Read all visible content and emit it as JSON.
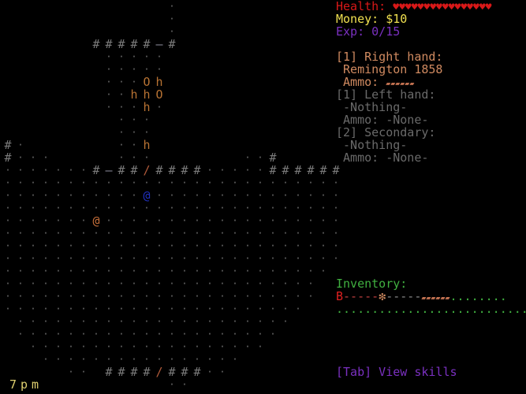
{
  "hud": {
    "health_label": "Health: ",
    "health_hearts": "♥♥♥♥♥♥♥♥♥♥♥♥♥♥♥♥",
    "money": "Money: $10",
    "exp": "Exp: 0/15",
    "right_hand_title": "[1] Right hand:",
    "right_hand_item": " Remington 1858",
    "right_hand_ammo_label": " Ammo: ",
    "right_hand_ammo_glyphs": "▰▰▰▰▰▰",
    "left_hand_title": "[1] Left hand:",
    "left_hand_item": " -Nothing-",
    "left_hand_ammo": " Ammo: -None-",
    "secondary_title": "[2] Secondary:",
    "secondary_item": " -Nothing-",
    "secondary_ammo": " Ammo: -None-",
    "inventory_title": "Inventory:",
    "inventory_row1_start": "B",
    "inventory_row1_a": "-----",
    "inventory_row1_b": "❇",
    "inventory_row1_c": "-----",
    "inventory_row1_d": "▰▰▰▰▰▰",
    "inventory_row1_e": "........",
    "inventory_row2": "..............................",
    "skills_hint": "[Tab] View skills"
  },
  "clock": "7pm",
  "colors": {
    "health": "#d81818",
    "money": "#f0e050",
    "exp": "#7a30c0",
    "weapon": "#d08a60",
    "inactive": "#6a6a6a",
    "inventory": "#40b040",
    "skills": "#7a30c0"
  }
}
